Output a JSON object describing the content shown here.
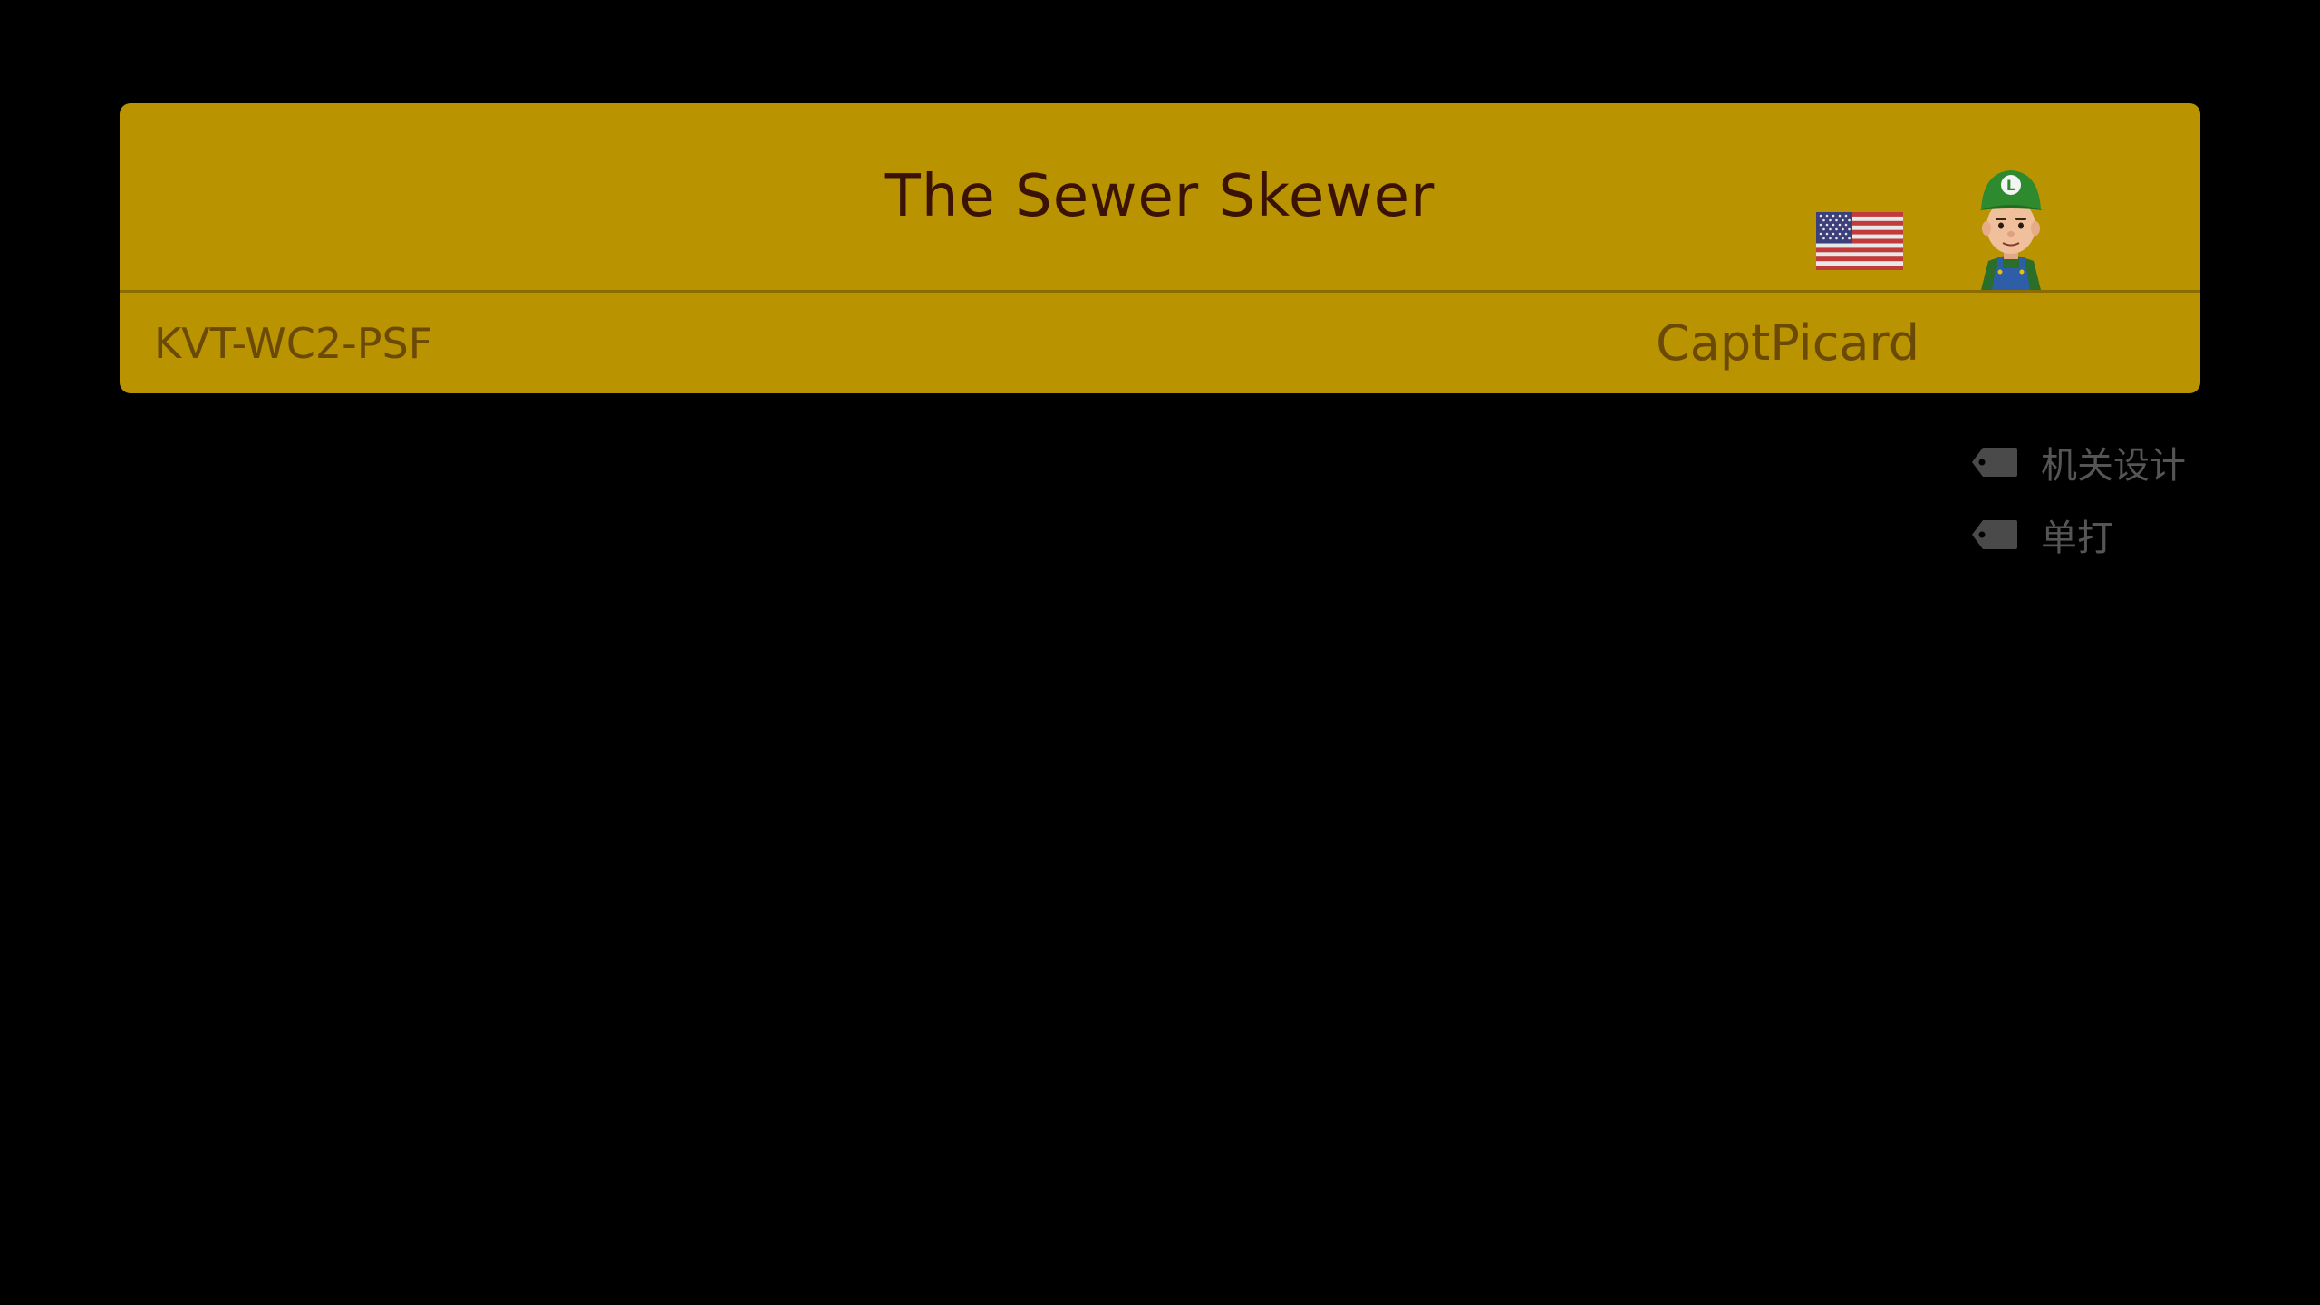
{
  "course": {
    "title": "The Sewer Skewer",
    "course_id": "KVT-WC2-PSF",
    "maker_name": "CaptPicard",
    "maker_country_flag": "us-flag-icon",
    "maker_avatar": "luigi-mii-avatar"
  },
  "tags": [
    {
      "label": "机关设计",
      "icon": "tag-icon"
    },
    {
      "label": "单打",
      "icon": "tag-icon"
    }
  ],
  "colors": {
    "background": "#000000",
    "card": "#b99400",
    "title_text": "#3a1206",
    "secondary_text": "#6b4a08",
    "tag_text": "#555555"
  }
}
